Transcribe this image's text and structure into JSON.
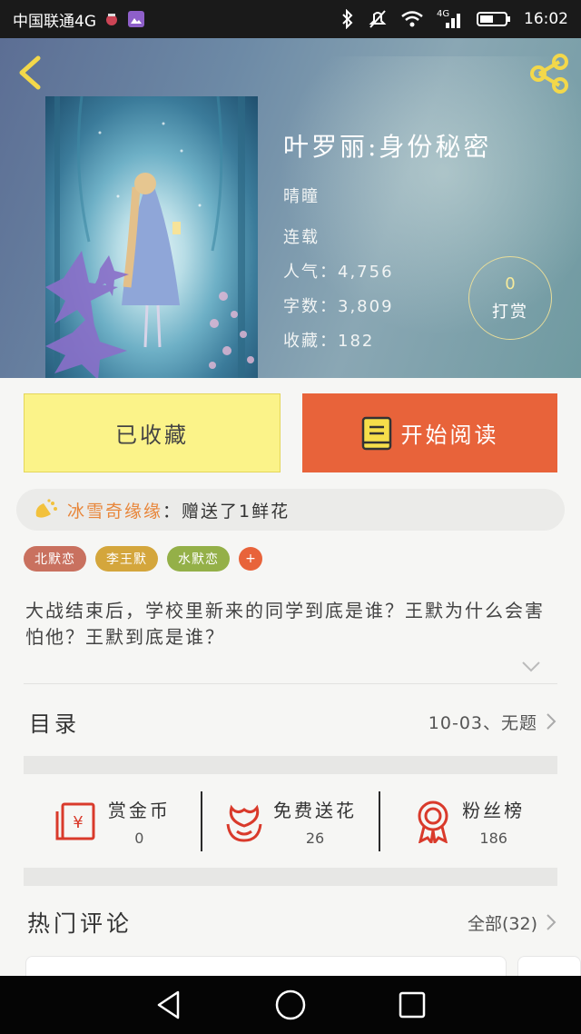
{
  "status_bar": {
    "carrier": "中国联通4G",
    "time": "16:02",
    "network": "4G"
  },
  "book": {
    "title": "叶罗丽:身份秘密",
    "author": "晴瞳",
    "status": "连载",
    "popularity": "人气：4,756",
    "word_count": "字数：3,809",
    "favorites": "收藏：182"
  },
  "reward": {
    "count": "0",
    "label": "打赏"
  },
  "actions": {
    "collected_label": "已收藏",
    "read_label": "开始阅读"
  },
  "gift_banner": {
    "user": "冰雪奇缘缘",
    "message": "：赠送了1鲜花"
  },
  "tags": [
    {
      "label": "北默恋",
      "color": "#c9715f"
    },
    {
      "label": "李王默",
      "color": "#d4a63c"
    },
    {
      "label": "水默恋",
      "color": "#94b048"
    }
  ],
  "tags_more": "+",
  "description": "大战结束后，学校里新来的同学到底是谁？王默为什么会害怕他？王默到底是谁？",
  "toc": {
    "label": "目录",
    "latest_chapter": "10-03、无题"
  },
  "stats": [
    {
      "label": "赏金币",
      "value": "0",
      "icon": "money-envelope-icon"
    },
    {
      "label": "免费送花",
      "value": "26",
      "icon": "flower-icon"
    },
    {
      "label": "粉丝榜",
      "value": "186",
      "icon": "medal-icon"
    }
  ],
  "comments": {
    "label": "热门评论",
    "all_label": "全部(32)"
  },
  "colors": {
    "accent": "#e8633a",
    "collected_bg": "#fbf389",
    "gift_user": "#e8863a",
    "icon_red": "#d93a2b"
  }
}
